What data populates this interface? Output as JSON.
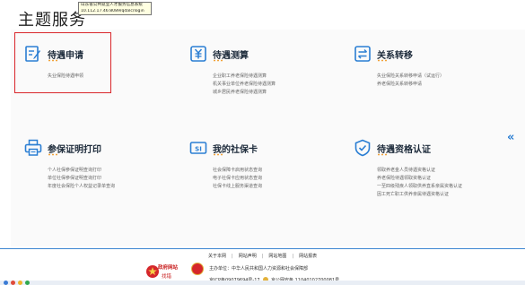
{
  "tooltip": {
    "line1": "山东省公共就业人才服务信息系统",
    "line2": "10.112.17.46:8089/qdalc/login"
  },
  "page_title": "主题服务",
  "colors": {
    "accent": "#2a7ed3",
    "dots": "#f2a33a",
    "highlight": "#d9262b"
  },
  "cards": [
    {
      "title": "待遇申请",
      "icon": "edit-form-icon",
      "links": [
        "失业保险待遇申领"
      ]
    },
    {
      "title": "待遇测算",
      "icon": "yuan-calculator-icon",
      "links": [
        "企业职工养老保险待遇测算",
        "机关事业单位养老保险待遇测算",
        "城乡居民养老保险待遇测算"
      ]
    },
    {
      "title": "关系转移",
      "icon": "transfer-icon",
      "links": [
        "失业保险关系转移申请（试运行）",
        "养老保险关系转移申请"
      ]
    },
    {
      "title": "参保证明打印",
      "icon": "printer-icon",
      "links": [
        "个人社保参保证明查询打印",
        "单位社保参保证明查询打印",
        "年度社会保险个人权益记录单查询"
      ]
    },
    {
      "title": "我的社保卡",
      "icon": "social-security-card-icon",
      "links": [
        "社会保障卡启用状态查询",
        "电子社保卡应用状态查询",
        "社保卡线上服务渠道查询"
      ]
    },
    {
      "title": "待遇资格认证",
      "icon": "shield-check-icon",
      "links": [
        "领取养老金人员待遇资格认证",
        "养老保险待遇领取资格认证",
        "一至四级残疾人领取供养直系亲属资格认证",
        "因工死亡职工供养亲属待遇资格认证"
      ]
    }
  ],
  "footer": {
    "links": [
      "关于本网",
      "网站声明",
      "网站地图",
      "网站报表"
    ],
    "gov_logo_line1": "政府网站",
    "gov_logo_line2": "找错",
    "sponsor": "主办单位：中华人民共和国人力资源和社会保障部",
    "icp": "京ICP备09079694号-17",
    "police": "京公网安备 11040102700081号"
  }
}
